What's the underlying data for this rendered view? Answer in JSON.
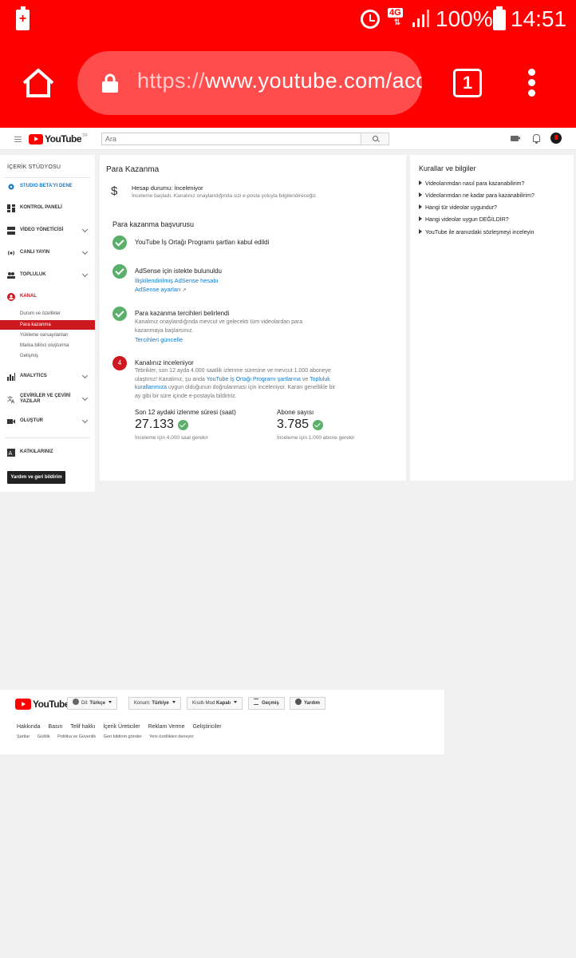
{
  "status_bar": {
    "network": "4G",
    "battery_percent": "100%",
    "time": "14:51"
  },
  "browser": {
    "url_scheme": "https://",
    "url_rest": "www.youtube.com/acc",
    "tab_count": "1"
  },
  "yt_header": {
    "logo_text": "YouTube",
    "logo_region": "TR",
    "search_placeholder": "Ara"
  },
  "sidebar": {
    "title": "İÇERİK STÜDYOSU",
    "items": [
      {
        "label": "STUDIO BETA'YI DENE"
      },
      {
        "label": "KONTROL PANELİ"
      },
      {
        "label": "VİDEO YÖNETİCİSİ"
      },
      {
        "label": "CANLI YAYIN"
      },
      {
        "label": "TOPLULUK"
      },
      {
        "label": "KANAL"
      },
      {
        "label": "ANALYTICS"
      },
      {
        "label": "ÇEVİRİLER VE ÇEVİRİ YAZILAR"
      },
      {
        "label": "OLUŞTUR"
      },
      {
        "label": "KATKILARINIZ"
      }
    ],
    "sub_items": [
      "Durum ve özellikler",
      "Para kazanma",
      "Yükleme varsayılanları",
      "Marka bilinci oluşturma",
      "Gelişmiş"
    ],
    "help_button": "Yardım ve geri bildirim"
  },
  "main": {
    "title": "Para Kazanma",
    "account_status": "Hesap durumu: İnceleniyor",
    "account_desc": "İnceleme başladı. Kanalınız onaylandığında sizi e-posta yoluyla bilgilendireceğiz.",
    "section_title": "Para kazanma başvurusu",
    "step1": {
      "title": "YouTube İş Ortağı Programı şartları kabul edildi"
    },
    "step2": {
      "title": "AdSense için istekte bulunuldu",
      "link1": "İlişkilendirilmiş AdSense hesabı",
      "link2": "AdSense ayarları",
      "ext_icon": "↗"
    },
    "step3": {
      "title": "Para kazanma tercihleri belirlendi",
      "desc": "Kanalınız onaylandığında mevcut ve gelecekti tüm videolardan para kazanmaya başlarsınız.",
      "link": "Tercihleri güncelle"
    },
    "step4": {
      "number": "4",
      "title": "Kanalınız inceleniyor",
      "desc_a": "Tebrikler, son 12 ayda 4.000 saatlik izlenme süresine ve mevcut 1.000 aboneye ulaştınız! Kanalınız, şu anda ",
      "desc_link1": "YouTube İş Ortağı Programı şartlarına",
      "desc_b": " ve ",
      "desc_link2": "Topluluk kurallarımıza",
      "desc_c": " uygun olduğunun doğrulanması için inceleniyor. Kararı genellikle bir ay gibi bir süre içinde e-postayla bildiririz."
    },
    "metrics": [
      {
        "label": "Son 12 aydaki izlenme süresi (saat)",
        "value": "27.133",
        "note": "İnceleme için 4.000 saat gerekir"
      },
      {
        "label": "Abone sayısı",
        "value": "3.785",
        "note": "İnceleme için 1.000 abone gerekir"
      }
    ]
  },
  "rules": {
    "title": "Kurallar ve bilgiler",
    "items": [
      "Videolarımdan nasıl para kazanabilirim?",
      "Videolarımdan ne kadar para kazanabilirim?",
      "Hangi tür videolar uygundur?",
      "Hangi videolar uygun DEĞİLDİR?",
      "YouTube ile aranızdaki sözleşmeyi inceleyin"
    ]
  },
  "footer": {
    "logo_text": "YouTube",
    "language_label": "Dil:",
    "language_value": "Türkçe",
    "location_label": "Konum:",
    "location_value": "Türkiye",
    "restricted_label": "Kısıtlı Mod",
    "restricted_value": "Kapalı",
    "history": "Geçmiş",
    "help": "Yardım",
    "links_primary": [
      "Hakkında",
      "Basın",
      "Telif hakkı",
      "İçerik Üreticiler",
      "Reklam Verme",
      "Geliştiriciler"
    ],
    "links_secondary": [
      "Şartlar",
      "Gizlilik",
      "Politika ve Güvenlik",
      "Geri bildirim gönder",
      "Yeni özellikleri deneyin"
    ]
  }
}
